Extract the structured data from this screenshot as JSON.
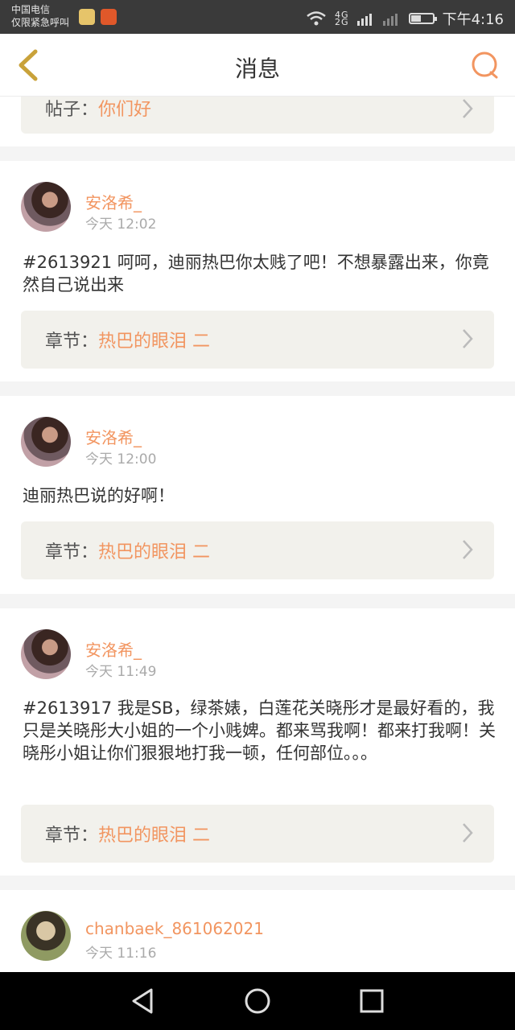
{
  "status_bar": {
    "carrier_line1": "中国电信",
    "carrier_line2": "仅限紧急呼叫",
    "signal_label_top": "4G",
    "signal_label_bottom": "2G",
    "time": "下午4:16",
    "battery_level": 0.45,
    "icons": [
      "app-star-icon",
      "app-play-icon",
      "wifi-icon",
      "signal-icon",
      "battery-icon"
    ]
  },
  "header": {
    "title": "消息",
    "back_icon": "chevron-left-icon",
    "search_icon": "search-icon"
  },
  "messages": [
    {
      "link_key": "帖子：",
      "link_value": "你们好"
    },
    {
      "username": "安洛希_",
      "time": "今天 12:02",
      "text": "#2613921 呵呵，迪丽热巴你太贱了吧！不想暴露出来，你竟然自己说出来",
      "link_key": "章节：",
      "link_value": "热巴的眼泪 二"
    },
    {
      "username": "安洛希_",
      "time": "今天 12:00",
      "text": "迪丽热巴说的好啊！",
      "link_key": "章节：",
      "link_value": "热巴的眼泪 二"
    },
    {
      "username": "安洛希_",
      "time": "今天 11:49",
      "text": "#2613917 我是SB，绿茶婊，白莲花关晓彤才是最好看的，我只是关晓彤大小姐的一个小贱婢。都来骂我啊！都来打我啊！关晓彤小姐让你们狠狠地打我一顿，任何部位。。。",
      "link_key": "章节：",
      "link_value": "热巴的眼泪 二"
    },
    {
      "username": "chanbaek_861062021",
      "time": "今天 11:16"
    }
  ],
  "nav": {
    "icons": [
      "nav-back-icon",
      "nav-home-icon",
      "nav-recents-icon"
    ]
  },
  "colors": {
    "accent": "#f29560",
    "link_box_bg": "#f2f1ec",
    "page_bg": "#f4f4f4",
    "status_bar_bg": "#3a3a3a"
  }
}
